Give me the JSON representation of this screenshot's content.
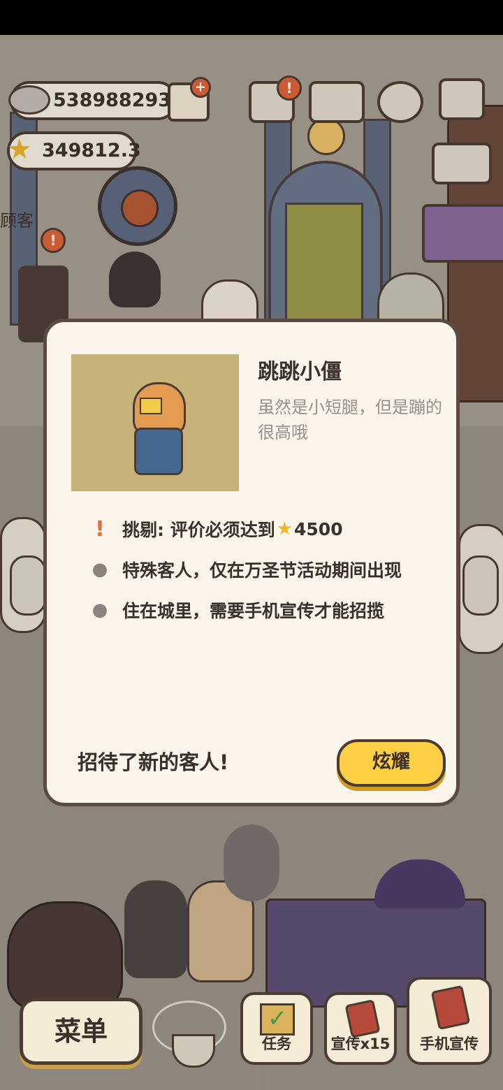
{
  "currency": {
    "fish": "538988293",
    "stars": "349812.3"
  },
  "scene": {
    "sign_partial": "顾客"
  },
  "modal": {
    "name": "跳跳小僵",
    "description": "虽然是小短腿，但是蹦的很高哦",
    "requirements": [
      {
        "icon": "exclamation-icon",
        "text": "挑剔: 评价必须达到",
        "value": "4500"
      },
      {
        "icon": "paw-icon",
        "text": "特殊客人，仅在万圣节活动期间出现"
      },
      {
        "icon": "paw-icon",
        "text": "住在城里，需要手机宣传才能招揽"
      }
    ],
    "footer_text": "招待了新的客人!",
    "button_label": "炫耀"
  },
  "bottom_bar": {
    "menu_label": "菜单",
    "task_label": "任务",
    "promo15_label": "宣传x15",
    "phone_promo_label": "手机宣传"
  },
  "colors": {
    "modal_bg": "#fbf5ec",
    "button_accent": "#ffcf44",
    "border": "#4a3b33"
  }
}
